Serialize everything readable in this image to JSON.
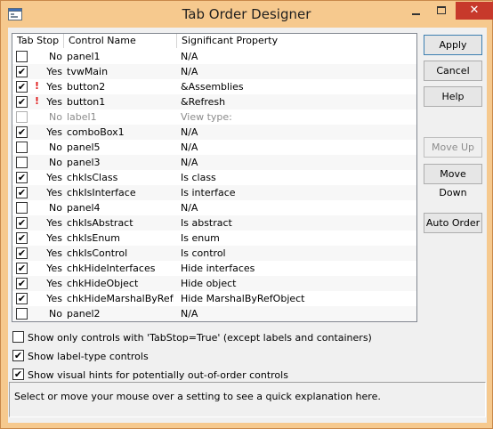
{
  "window": {
    "title": "Tab Order Designer",
    "close_glyph": "✕"
  },
  "list": {
    "columns": [
      "Tab Stop",
      "Control Name",
      "Significant Property"
    ],
    "rows": [
      {
        "checked": false,
        "warn": false,
        "stop": "No",
        "name": "panel1",
        "prop": "N/A",
        "disabled": false
      },
      {
        "checked": true,
        "warn": false,
        "stop": "Yes",
        "name": "tvwMain",
        "prop": "N/A",
        "disabled": false
      },
      {
        "checked": true,
        "warn": true,
        "stop": "Yes",
        "name": "button2",
        "prop": "&Assemblies",
        "disabled": false
      },
      {
        "checked": true,
        "warn": true,
        "stop": "Yes",
        "name": "button1",
        "prop": "&Refresh",
        "disabled": false
      },
      {
        "checked": false,
        "warn": false,
        "stop": "No",
        "name": "label1",
        "prop": "View type:",
        "disabled": true
      },
      {
        "checked": true,
        "warn": false,
        "stop": "Yes",
        "name": "comboBox1",
        "prop": "N/A",
        "disabled": false
      },
      {
        "checked": false,
        "warn": false,
        "stop": "No",
        "name": "panel5",
        "prop": "N/A",
        "disabled": false
      },
      {
        "checked": false,
        "warn": false,
        "stop": "No",
        "name": "panel3",
        "prop": "N/A",
        "disabled": false
      },
      {
        "checked": true,
        "warn": false,
        "stop": "Yes",
        "name": "chkIsClass",
        "prop": "Is class",
        "disabled": false
      },
      {
        "checked": true,
        "warn": false,
        "stop": "Yes",
        "name": "chkIsInterface",
        "prop": "Is interface",
        "disabled": false
      },
      {
        "checked": false,
        "warn": false,
        "stop": "No",
        "name": "panel4",
        "prop": "N/A",
        "disabled": false
      },
      {
        "checked": true,
        "warn": false,
        "stop": "Yes",
        "name": "chkIsAbstract",
        "prop": "Is abstract",
        "disabled": false
      },
      {
        "checked": true,
        "warn": false,
        "stop": "Yes",
        "name": "chkIsEnum",
        "prop": "Is enum",
        "disabled": false
      },
      {
        "checked": true,
        "warn": false,
        "stop": "Yes",
        "name": "chkIsControl",
        "prop": "Is control",
        "disabled": false
      },
      {
        "checked": true,
        "warn": false,
        "stop": "Yes",
        "name": "chkHideInterfaces",
        "prop": "Hide interfaces",
        "disabled": false
      },
      {
        "checked": true,
        "warn": false,
        "stop": "Yes",
        "name": "chkHideObject",
        "prop": "Hide object",
        "disabled": false
      },
      {
        "checked": true,
        "warn": false,
        "stop": "Yes",
        "name": "chkHideMarshalByRef...",
        "prop": "Hide MarshalByRefObject",
        "disabled": false
      },
      {
        "checked": false,
        "warn": false,
        "stop": "No",
        "name": "panel2",
        "prop": "N/A",
        "disabled": false
      }
    ]
  },
  "buttons": {
    "apply": "Apply",
    "cancel": "Cancel",
    "help": "Help",
    "move_up": "Move Up",
    "move_down": "Move Down",
    "auto_order": "Auto Order"
  },
  "options": [
    {
      "checked": false,
      "label": "Show only controls with 'TabStop=True' (except labels and containers)"
    },
    {
      "checked": true,
      "label": "Show label-type controls"
    },
    {
      "checked": true,
      "label": "Show visual hints for potentially out-of-order controls"
    }
  ],
  "hint_text": "Select or move your mouse over a setting to see a quick explanation here.",
  "colors": {
    "frame": "#f6c98e",
    "close": "#c7392b",
    "warning": "#e01b1b"
  },
  "icons": {
    "app": "tab-order-app-icon",
    "warning": "exclamation-icon",
    "check": "check-icon"
  }
}
